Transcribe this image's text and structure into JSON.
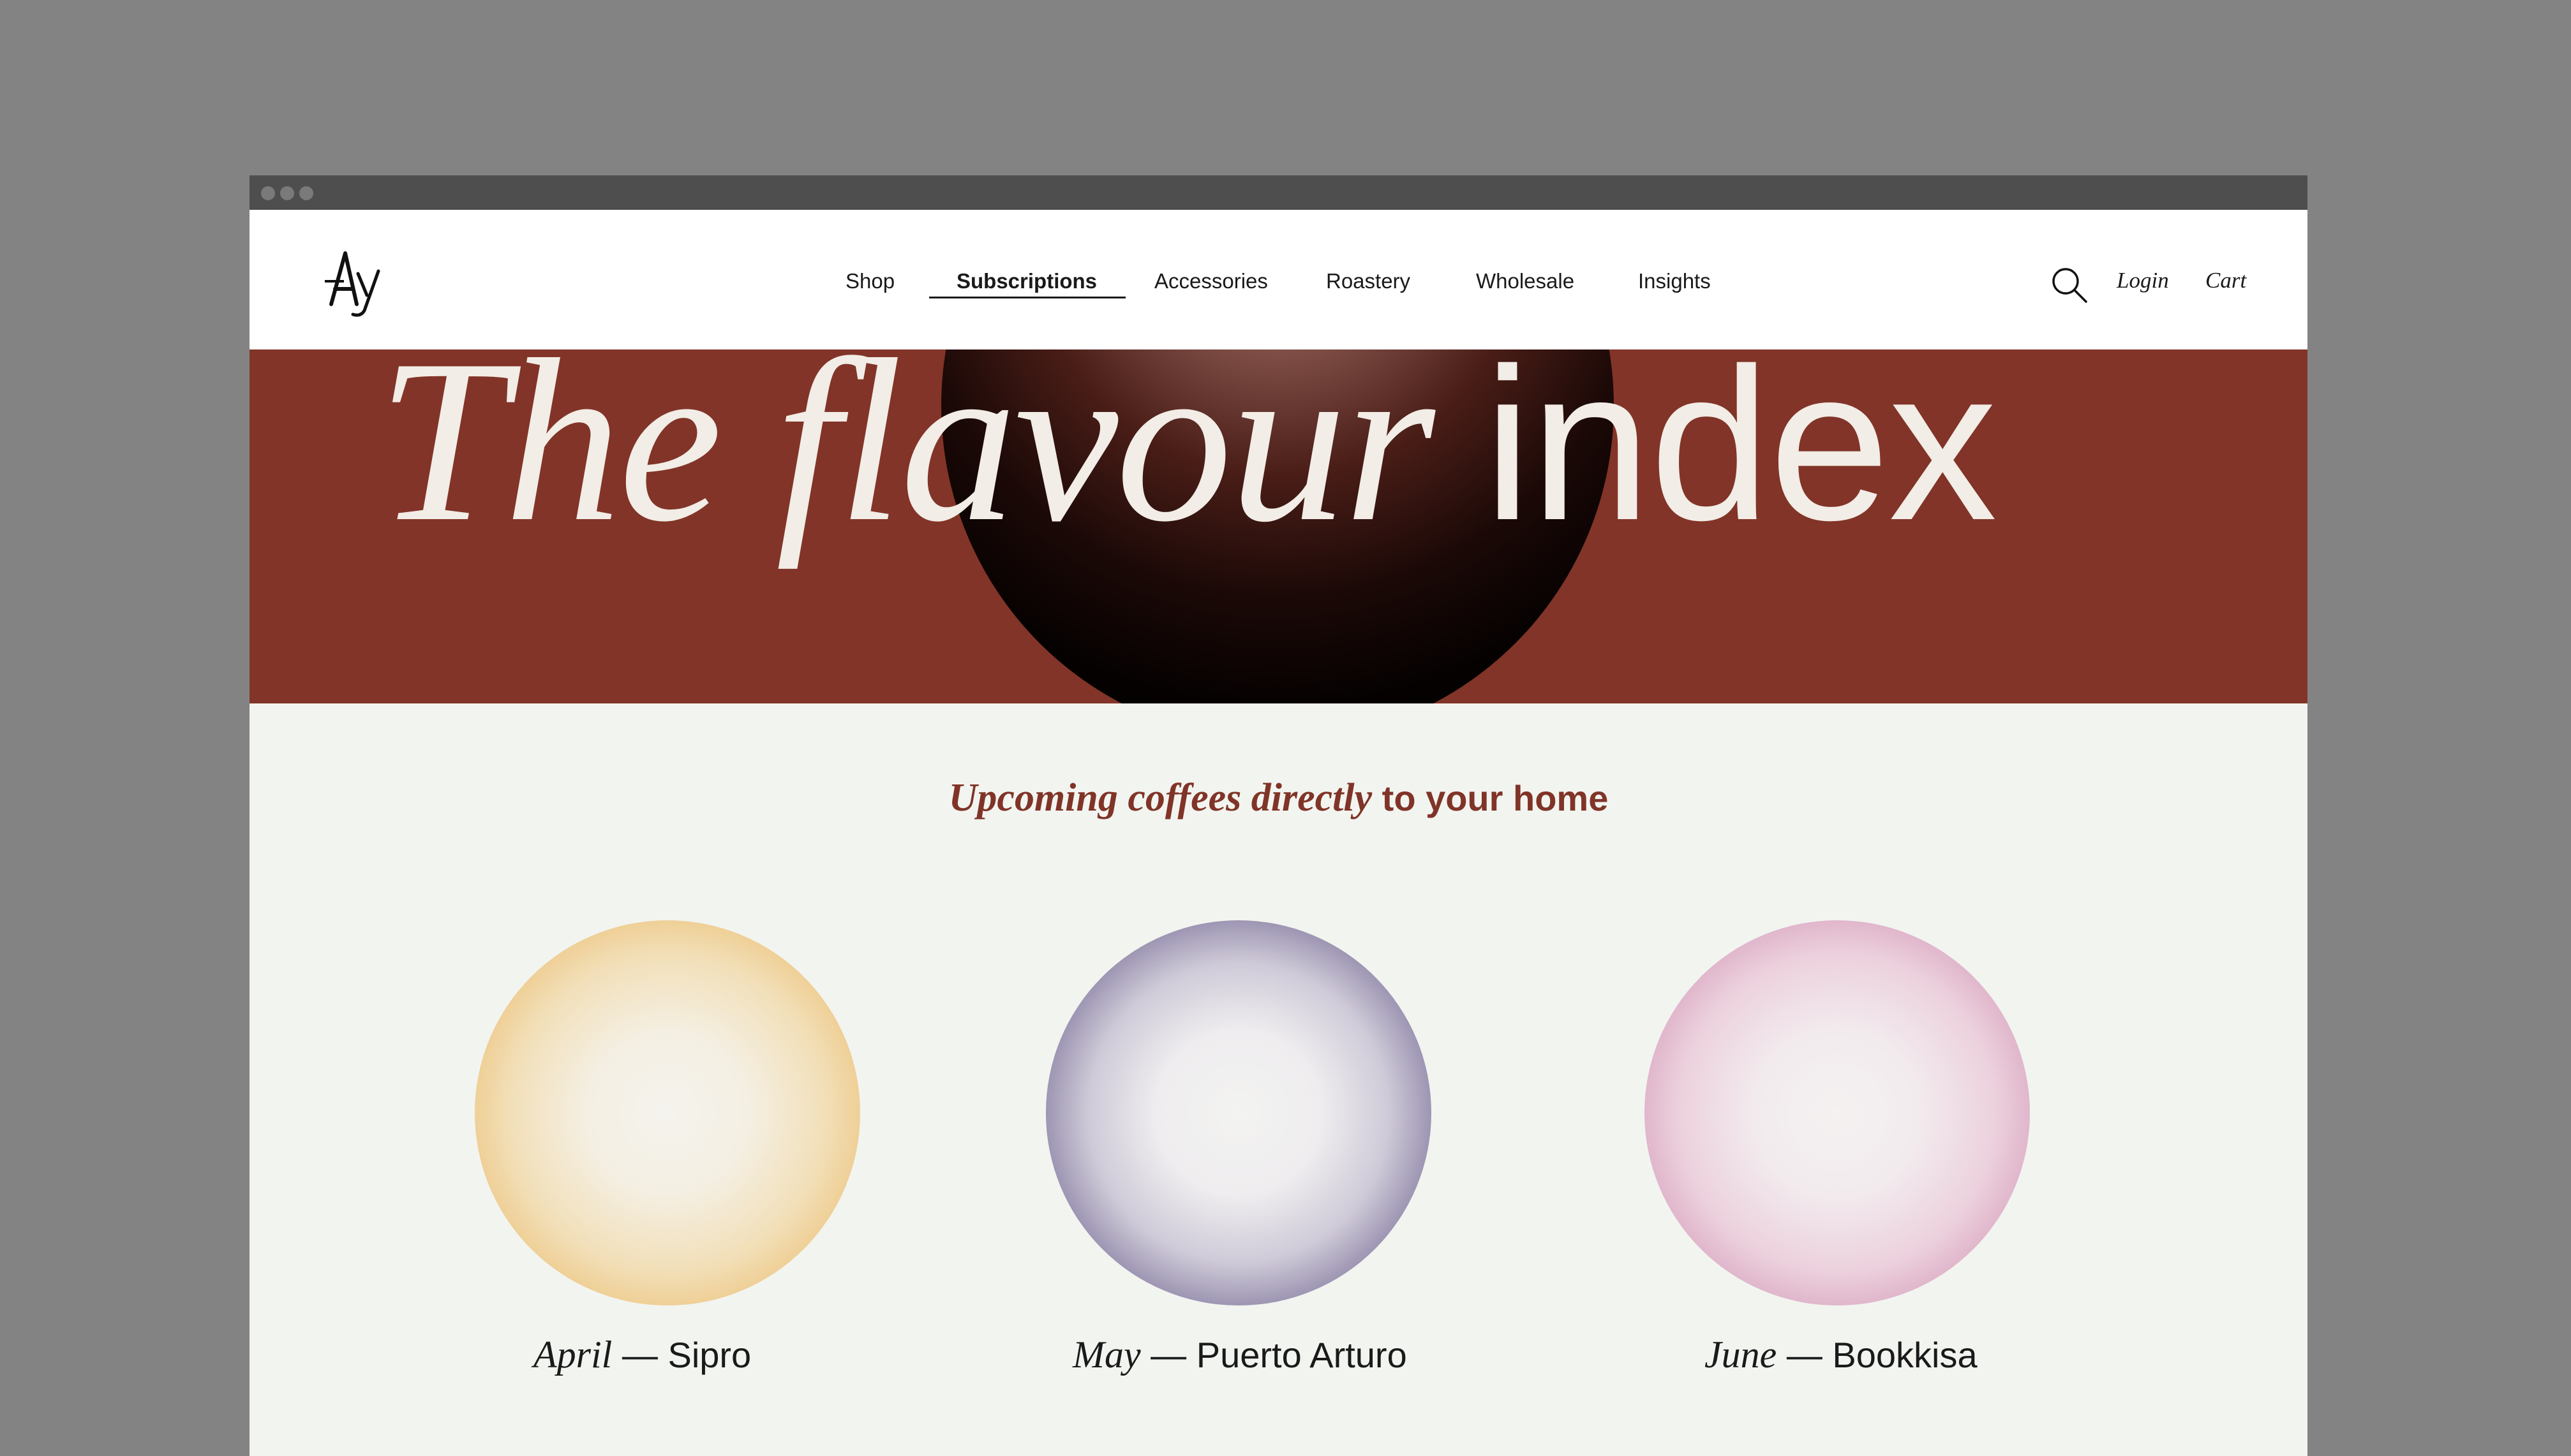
{
  "nav": {
    "logo_alt": "Ay",
    "items": [
      {
        "label": "Shop"
      },
      {
        "label": "Subscriptions",
        "active": true
      },
      {
        "label": "Accessories"
      },
      {
        "label": "Roastery"
      },
      {
        "label": "Wholesale"
      },
      {
        "label": "Insights"
      }
    ],
    "search_icon": "search-icon",
    "login_label": "Login",
    "cart_label": "Cart"
  },
  "hero": {
    "title_italic": "The flavour",
    "title_sans": "index",
    "background_color": "#823428"
  },
  "subtitle": {
    "emphasis": "Upcoming coffees directly",
    "rest": " to your home",
    "color": "#803427"
  },
  "coffees": [
    {
      "month": "April",
      "separator": " — ",
      "name": "Sipro",
      "color": "#e3a84e"
    },
    {
      "month": "May",
      "separator": " — ",
      "name": "Puerto Arturo",
      "color": "#3d2f5f"
    },
    {
      "month": "June",
      "separator": " — ",
      "name": "Bookkisa",
      "color": "#c27fa9"
    }
  ]
}
